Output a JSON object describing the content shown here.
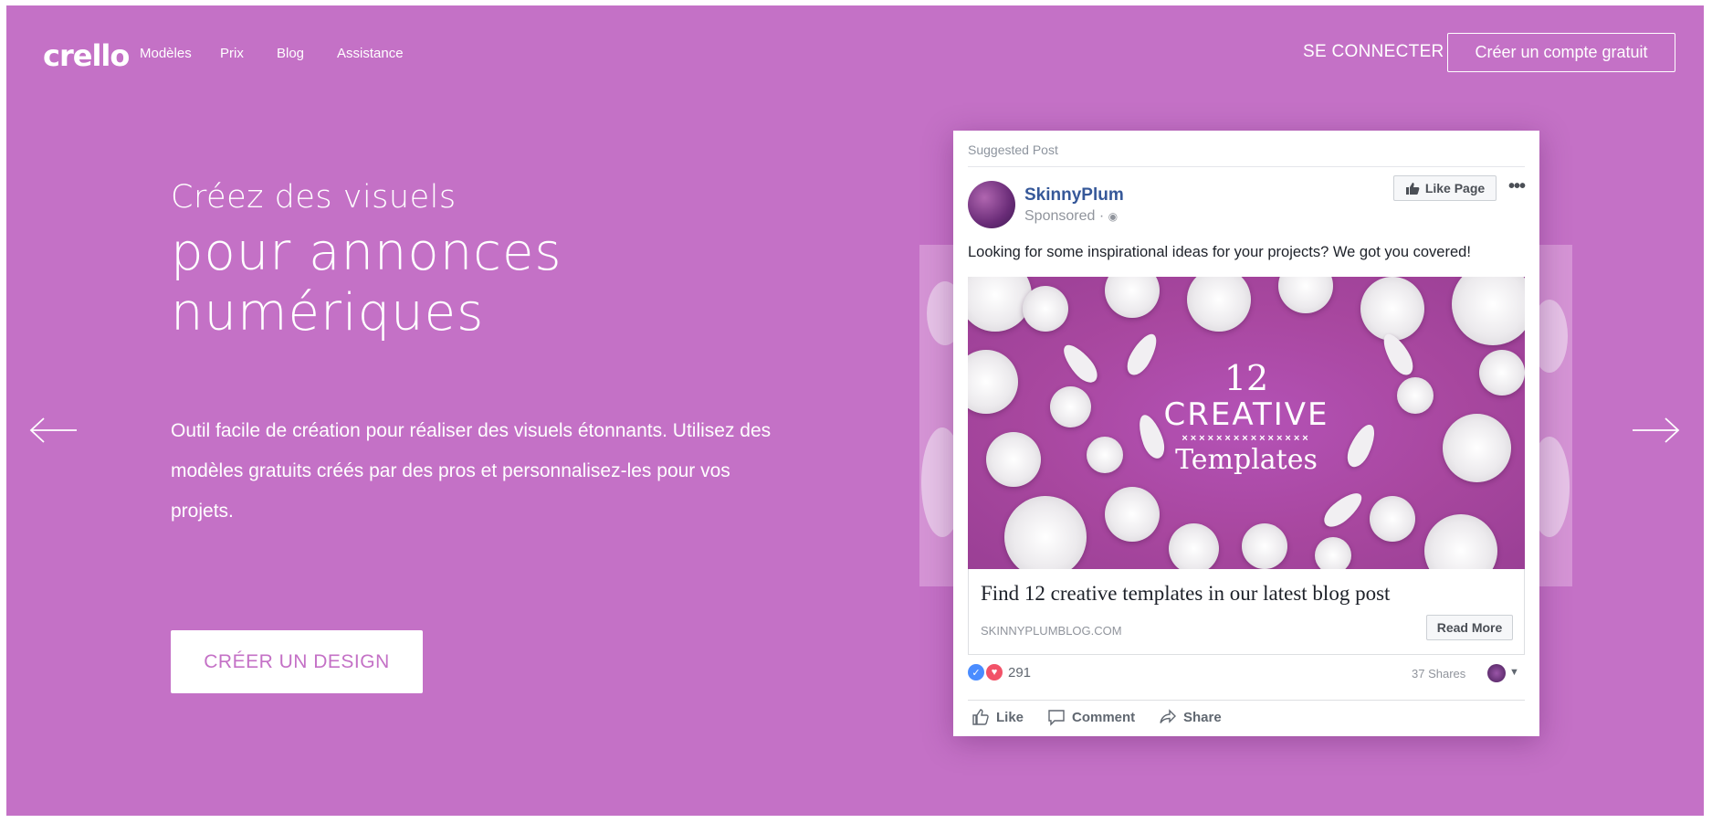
{
  "header": {
    "logo": "crello",
    "nav": [
      "Modèles",
      "Prix",
      "Blog",
      "Assistance"
    ],
    "login": "SE CONNECTER",
    "signup": "Créer un compte gratuit"
  },
  "hero": {
    "line1": "Créez des visuels",
    "line2": "pour annonces numériques",
    "description": "Outil facile de création pour réaliser des visuels étonnants. Utilisez des modèles gratuits créés par des pros et personnalisez-les pour vos projets.",
    "cta": "CRÉER UN DESIGN",
    "bg_color": "#c471c6"
  },
  "icons": {
    "prev": "arrow-left-icon",
    "next": "arrow-right-icon"
  },
  "post": {
    "suggested": "Suggested Post",
    "page_name": "SkinnyPlum",
    "sponsored": "Sponsored · ",
    "like_page": "Like Page",
    "more": "•••",
    "text": "Looking for some inspirational ideas for your projects? We got you covered!",
    "image": {
      "number": "12",
      "creative": "CREATIVE",
      "xs": "×××××××××××××××",
      "templates": "Templates"
    },
    "link_title": "Find 12 creative templates in our latest blog post",
    "link_domain": "SKINNYPLUMBLOG.COM",
    "read_more": "Read More",
    "reactions_count": "291",
    "shares": "37 Shares",
    "actions": {
      "like": "Like",
      "comment": "Comment",
      "share": "Share"
    }
  }
}
